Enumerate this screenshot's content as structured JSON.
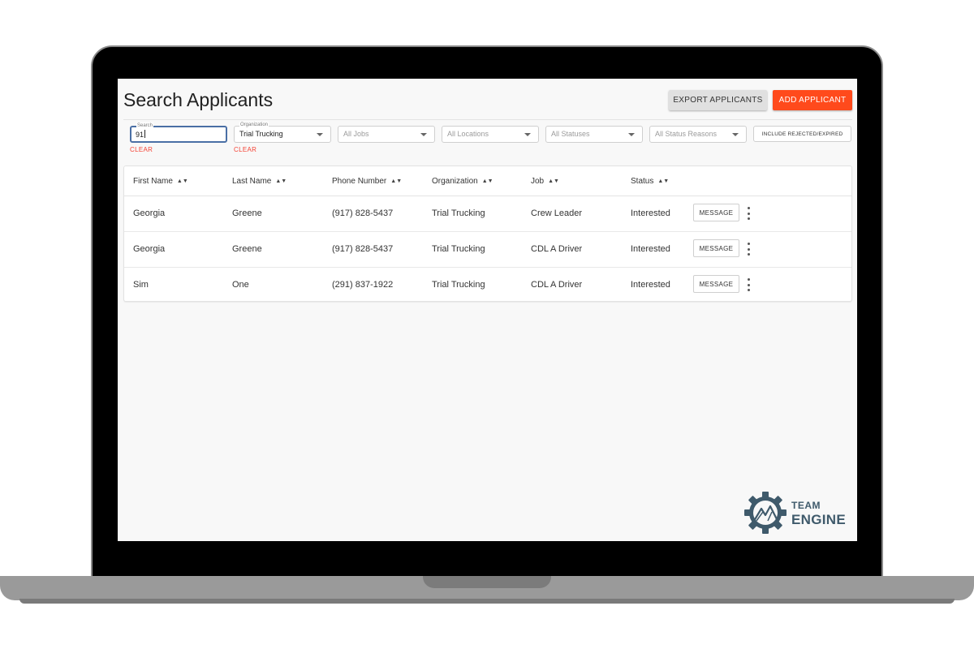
{
  "page": {
    "title": "Search Applicants"
  },
  "toolbar": {
    "export_label": "EXPORT APPLICANTS",
    "add_label": "ADD APPLICANT"
  },
  "filters": {
    "search": {
      "label": "Search",
      "value": "91",
      "clear_label": "CLEAR"
    },
    "organization": {
      "label": "Organization",
      "value": "Trial Trucking",
      "clear_label": "CLEAR"
    },
    "jobs": {
      "value": "All Jobs"
    },
    "locations": {
      "value": "All Locations"
    },
    "statuses": {
      "value": "All Statuses"
    },
    "status_reasons": {
      "value": "All Status Reasons"
    },
    "include_label": "INCLUDE REJECTED/EXPIRED"
  },
  "table": {
    "columns": [
      "First Name",
      "Last Name",
      "Phone Number",
      "Organization",
      "Job",
      "Status"
    ],
    "message_label": "MESSAGE",
    "rows": [
      [
        "Georgia",
        "Greene",
        "(917) 828-5437",
        "Trial Trucking",
        "Crew Leader",
        "Interested"
      ],
      [
        "Georgia",
        "Greene",
        "(917) 828-5437",
        "Trial Trucking",
        "CDL A Driver",
        "Interested"
      ],
      [
        "Sim",
        "One",
        "(291) 837-1922",
        "Trial Trucking",
        "CDL A Driver",
        "Interested"
      ]
    ]
  },
  "logo": {
    "line1": "TEAM",
    "line2": "ENGINE"
  },
  "colors": {
    "accent": "#ff4a1c",
    "clear_link": "#f44336",
    "logo": "#3f5a6b",
    "focus_border": "#4a6fa5"
  },
  "icons": {
    "sort": "sort-icon",
    "dropdown": "chevron-down-icon",
    "row_menu": "more-vertical-icon",
    "logo": "gear-mountain-logo-icon"
  }
}
